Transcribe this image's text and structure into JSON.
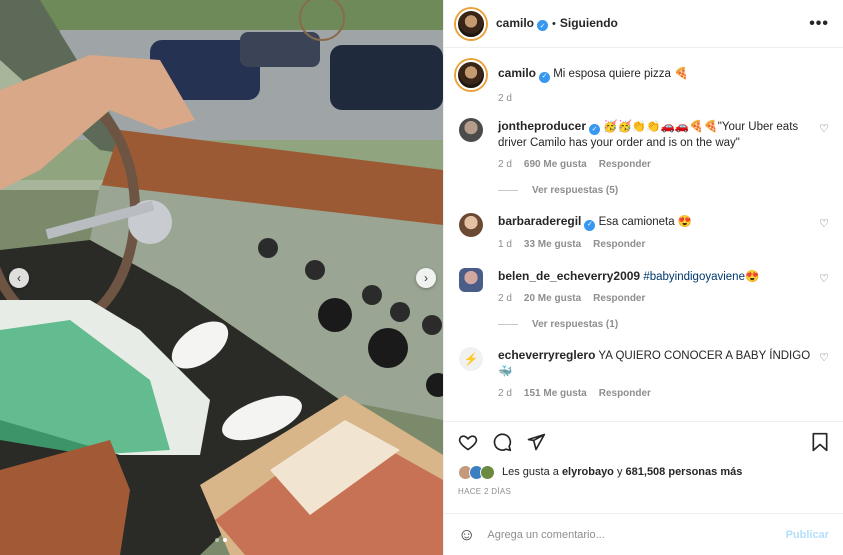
{
  "header": {
    "username": "camilo",
    "separator": "•",
    "follow_status": "Siguiendo",
    "more_glyph": "•••"
  },
  "caption": {
    "username": "camilo",
    "text": "Mi esposa quiere pizza 🍕",
    "time": "2 d"
  },
  "comments": [
    {
      "username": "jontheproducer",
      "verified": true,
      "text": "🥳🥳👏👏🚗🚗🍕🍕\"Your Uber eats driver Camilo has your order and is on the way\"",
      "time": "2 d",
      "likes": "690 Me gusta",
      "reply": "Responder",
      "view_replies": "Ver respuestas (5)"
    },
    {
      "username": "barbaraderegil",
      "verified": true,
      "text": "Esa camioneta 😍",
      "time": "1 d",
      "likes": "33 Me gusta",
      "reply": "Responder"
    },
    {
      "username": "belen_de_echeverry2009",
      "verified": false,
      "text": "#babyindigoyaviene😍",
      "time": "2 d",
      "likes": "20 Me gusta",
      "reply": "Responder",
      "view_replies": "Ver respuestas (1)"
    },
    {
      "username": "echeverryreglero",
      "verified": false,
      "text": "YA QUIERO CONOCER A BABY ÍNDIGO 🐳",
      "time": "2 d",
      "likes": "151 Me gusta",
      "reply": "Responder"
    }
  ],
  "likes_summary": {
    "prefix": "Les gusta a",
    "user": "elyrobayo",
    "joiner": "y",
    "others": "681,508 personas más"
  },
  "posted_ago": "HACE 2 DÍAS",
  "add_comment": {
    "placeholder": "Agrega un comentario...",
    "post_label": "Publicar"
  },
  "icons": {
    "verified": "verified-badge-icon",
    "comment_like": "heart-outline-icon",
    "like": "heart-icon",
    "comment": "comment-bubble-icon",
    "share": "paper-plane-icon",
    "save": "bookmark-icon",
    "emoji": "smiley-icon"
  },
  "colors": {
    "verified": "#3897f0",
    "link": "#00376b",
    "muted": "#8e8e8e",
    "publish_disabled": "#b2dffc"
  },
  "carousel": {
    "slides": 2,
    "current": 2
  }
}
